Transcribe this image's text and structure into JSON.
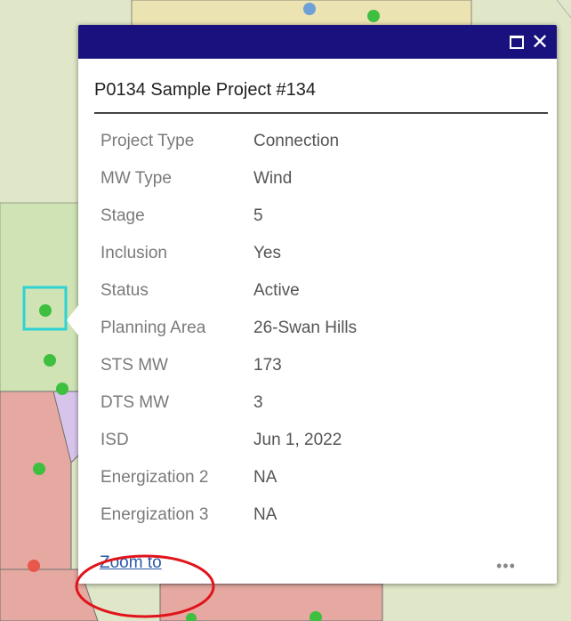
{
  "popup": {
    "title": "P0134 Sample Project #134",
    "rows": [
      {
        "label": "Project Type",
        "value": "Connection"
      },
      {
        "label": "MW Type",
        "value": "Wind"
      },
      {
        "label": "Stage",
        "value": "5"
      },
      {
        "label": "Inclusion",
        "value": "Yes"
      },
      {
        "label": "Status",
        "value": "Active"
      },
      {
        "label": "Planning Area",
        "value": "26-Swan Hills"
      },
      {
        "label": "STS MW",
        "value": "173"
      },
      {
        "label": "DTS MW",
        "value": "3"
      },
      {
        "label": "ISD",
        "value": "Jun 1, 2022"
      },
      {
        "label": "Energization 2",
        "value": "NA"
      },
      {
        "label": "Energization 3",
        "value": "NA"
      }
    ],
    "maximize_icon": "maximize-icon",
    "close_icon": "close-icon",
    "close_glyph": "✕",
    "zoom_label": "Zoom to",
    "more_glyph": "•••"
  },
  "colors": {
    "header": "#18117e",
    "annotation_circle": "#e0141b",
    "selection_box": "#2fd2d2",
    "point_green": "#3fbf3f",
    "point_red": "#e8574c",
    "point_blue": "#6e9fd6"
  }
}
